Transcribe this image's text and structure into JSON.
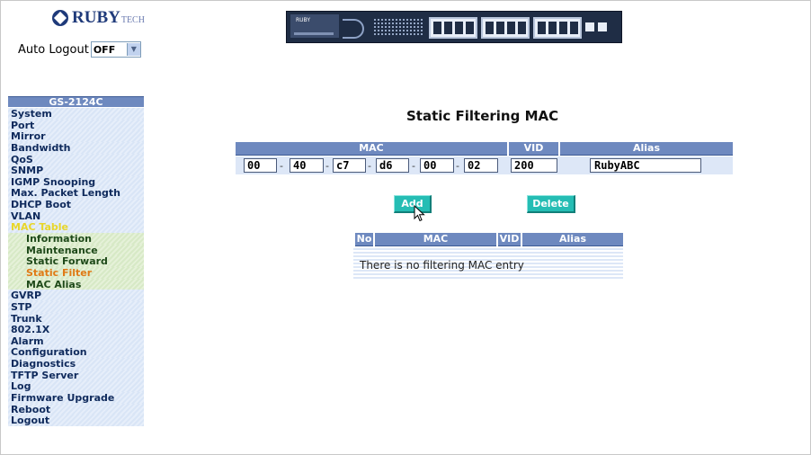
{
  "brand": {
    "name": "RUBY",
    "suffix": "TECH"
  },
  "auto_logout": {
    "label": "Auto Logout",
    "value": "OFF"
  },
  "device": {
    "brand_text": "RUBY"
  },
  "sidebar": {
    "title": "GS-2124C",
    "items": [
      {
        "label": "System"
      },
      {
        "label": "Port"
      },
      {
        "label": "Mirror"
      },
      {
        "label": "Bandwidth"
      },
      {
        "label": "QoS"
      },
      {
        "label": "SNMP"
      },
      {
        "label": "IGMP Snooping"
      },
      {
        "label": "Max. Packet Length"
      },
      {
        "label": "DHCP Boot"
      },
      {
        "label": "VLAN"
      },
      {
        "label": "MAC Table"
      },
      {
        "label": "Information"
      },
      {
        "label": "Maintenance"
      },
      {
        "label": "Static Forward"
      },
      {
        "label": "Static Filter"
      },
      {
        "label": "MAC Alias"
      },
      {
        "label": "GVRP"
      },
      {
        "label": "STP"
      },
      {
        "label": "Trunk"
      },
      {
        "label": "802.1X"
      },
      {
        "label": "Alarm"
      },
      {
        "label": "Configuration"
      },
      {
        "label": "Diagnostics"
      },
      {
        "label": "TFTP Server"
      },
      {
        "label": "Log"
      },
      {
        "label": "Firmware Upgrade"
      },
      {
        "label": "Reboot"
      },
      {
        "label": "Logout"
      }
    ]
  },
  "page": {
    "title": "Static Filtering MAC"
  },
  "form": {
    "headers": {
      "mac": "MAC",
      "vid": "VID",
      "alias": "Alias"
    },
    "mac_octets": [
      "00",
      "40",
      "c7",
      "d6",
      "00",
      "02"
    ],
    "separator": "-",
    "vid": "200",
    "alias": "RubyABC",
    "add_label": "Add",
    "delete_label": "Delete"
  },
  "list": {
    "headers": {
      "no": "No",
      "mac": "MAC",
      "vid": "VID",
      "alias": "Alias"
    },
    "empty_text": "There is no filtering MAC entry"
  },
  "colors": {
    "header_blue": "#6e89bf",
    "button_teal": "#25bdb4",
    "row_blue": "#dde7f7"
  }
}
